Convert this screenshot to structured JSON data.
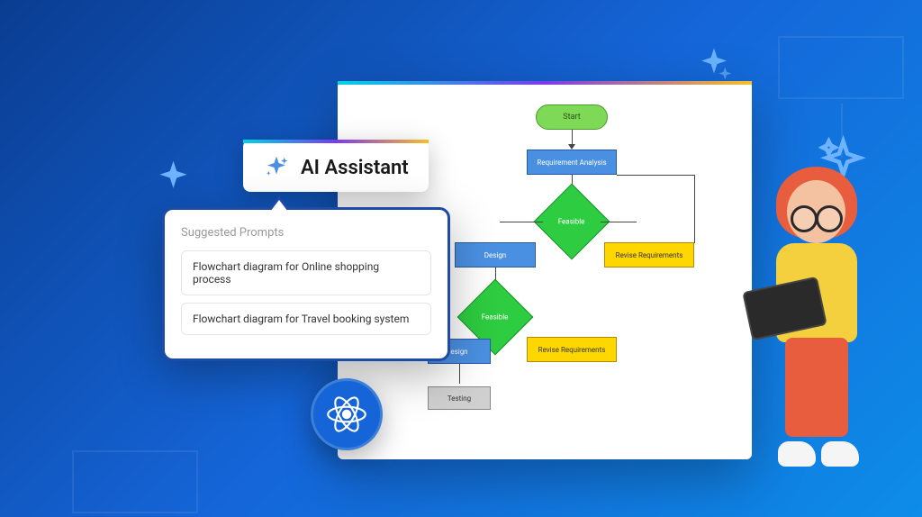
{
  "ai_chip": {
    "title": "AI Assistant"
  },
  "prompts": {
    "header": "Suggested Prompts",
    "items": [
      "Flowchart diagram for Online shopping process",
      "Flowchart diagram for Travel booking system"
    ]
  },
  "flowchart": {
    "start": "Start",
    "req_analysis": "Requirement Analysis",
    "feasible1": "Feasible",
    "design1": "Design",
    "revise1": "Revise Requirements",
    "feasible2": "Feasible",
    "design2": "esign",
    "revise2": "Revise Requirements",
    "testing": "Testing"
  },
  "colors": {
    "accent": "#1565d8",
    "start_node": "#7ed957",
    "decision": "#2ecc40",
    "process_blue": "#4a90e2",
    "process_yellow": "#ffd700"
  }
}
